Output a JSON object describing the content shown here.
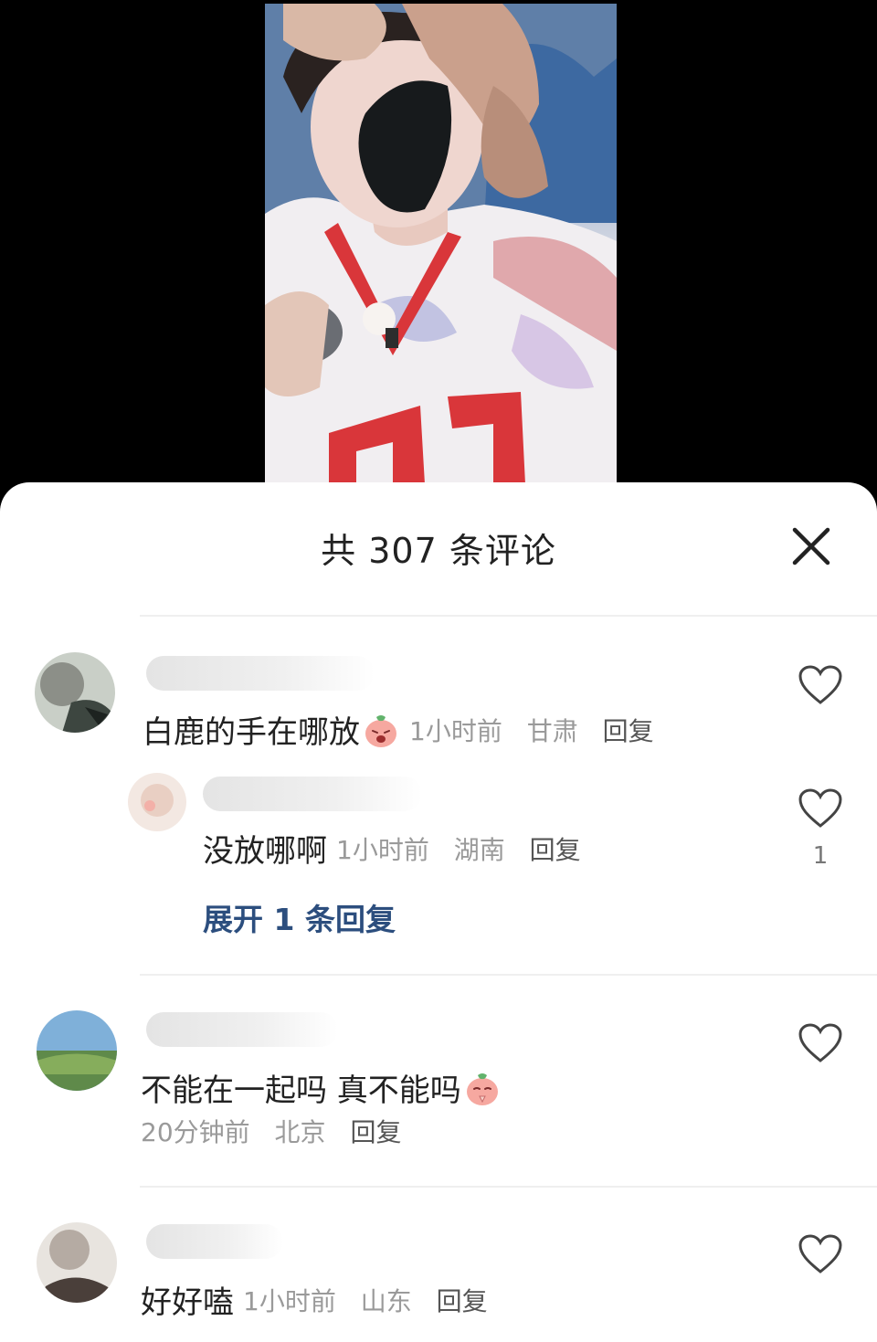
{
  "header": {
    "title": "共 307 条评论"
  },
  "comments": [
    {
      "text": "白鹿的手在哪放",
      "time": "1小时前",
      "location": "甘肃",
      "reply_label": "回复",
      "emoji": "peach-laugh-emoji"
    },
    {
      "text": "没放哪啊",
      "time": "1小时前",
      "location": "湖南",
      "reply_label": "回复",
      "likes": "1",
      "is_reply": true
    },
    {
      "text": "不能在一起吗 真不能吗",
      "time": "20分钟前",
      "location": "北京",
      "reply_label": "回复",
      "emoji": "peach-pray-emoji"
    },
    {
      "text": "好好嗑",
      "time": "1小时前",
      "location": "山东",
      "reply_label": "回复"
    }
  ],
  "expand_replies": "展开 1 条回复",
  "icons": {
    "close": "close-icon",
    "like": "heart-outline-icon"
  },
  "colors": {
    "link": "#2c4e7e",
    "meta": "#9a9a9a"
  }
}
